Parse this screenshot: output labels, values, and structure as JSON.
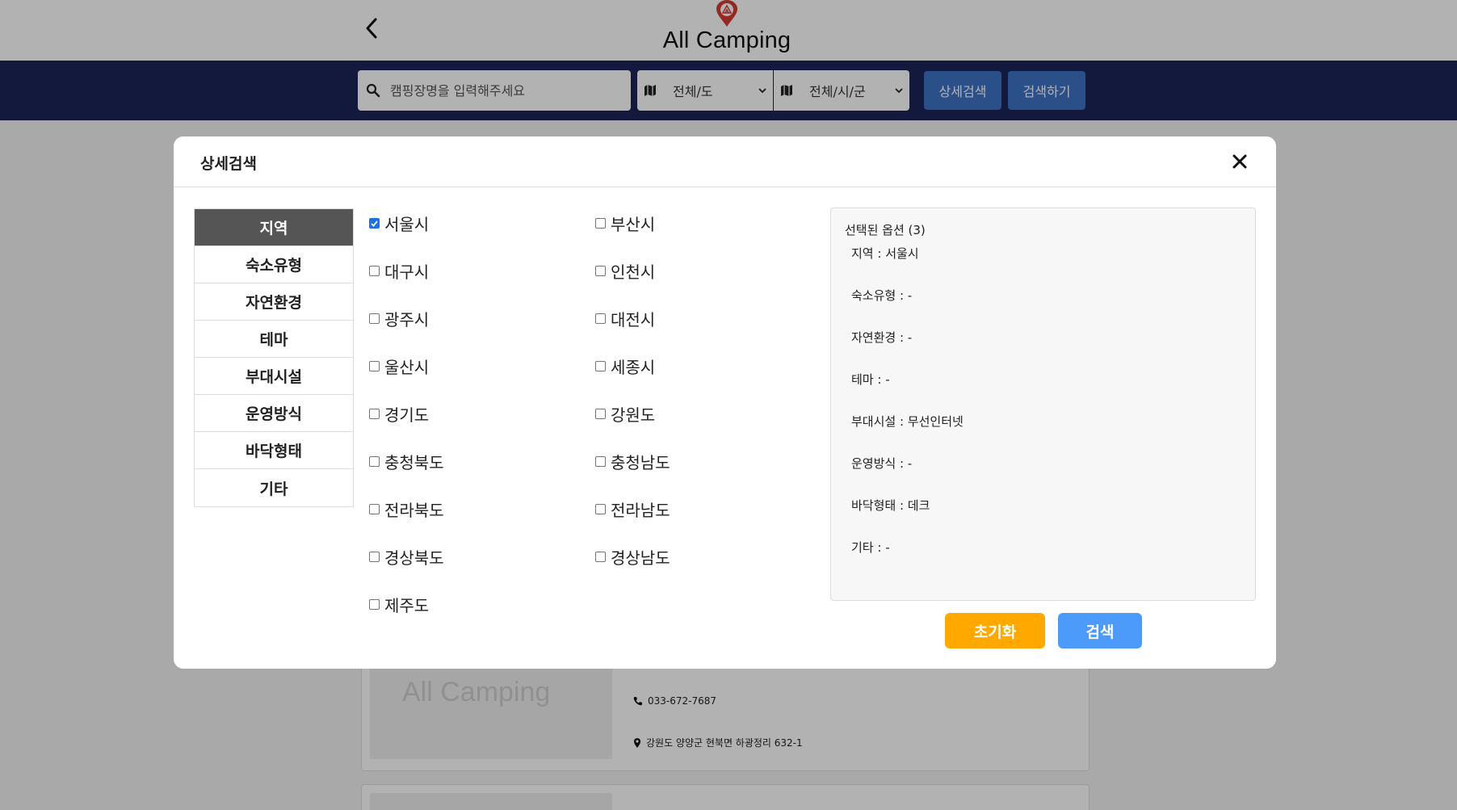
{
  "header": {
    "logo_text": "All Camping"
  },
  "search": {
    "placeholder": "캠핑장명을 입력해주세요",
    "province_select": "전체/도",
    "city_select": "전체/시/군",
    "detail_search_label": "상세검색",
    "search_label": "검색하기"
  },
  "background_listing": {
    "thumb_logo": "All Camping",
    "phone": "033-672-7687",
    "address": "강원도 양양군 현북면 하광정리 632-1"
  },
  "modal": {
    "title": "상세검색",
    "categories": [
      {
        "label": "지역",
        "active": true
      },
      {
        "label": "숙소유형",
        "active": false
      },
      {
        "label": "자연환경",
        "active": false
      },
      {
        "label": "테마",
        "active": false
      },
      {
        "label": "부대시설",
        "active": false
      },
      {
        "label": "운영방식",
        "active": false
      },
      {
        "label": "바닥형태",
        "active": false
      },
      {
        "label": "기타",
        "active": false
      }
    ],
    "regions": [
      {
        "label": "서울시",
        "checked": true
      },
      {
        "label": "부산시",
        "checked": false
      },
      {
        "label": "대구시",
        "checked": false
      },
      {
        "label": "인천시",
        "checked": false
      },
      {
        "label": "광주시",
        "checked": false
      },
      {
        "label": "대전시",
        "checked": false
      },
      {
        "label": "울산시",
        "checked": false
      },
      {
        "label": "세종시",
        "checked": false
      },
      {
        "label": "경기도",
        "checked": false
      },
      {
        "label": "강원도",
        "checked": false
      },
      {
        "label": "충청북도",
        "checked": false
      },
      {
        "label": "충청남도",
        "checked": false
      },
      {
        "label": "전라북도",
        "checked": false
      },
      {
        "label": "전라남도",
        "checked": false
      },
      {
        "label": "경상북도",
        "checked": false
      },
      {
        "label": "경상남도",
        "checked": false
      },
      {
        "label": "제주도",
        "checked": false
      }
    ],
    "summary": {
      "heading": "선택된 옵션 (3)",
      "rows": [
        "지역 : 서울시",
        "숙소유형 : -",
        "자연환경 : -",
        "테마 : -",
        "부대시설 : 무선인터넷",
        "운영방식 : -",
        "바닥형태 : 데크",
        "기타 : -"
      ]
    },
    "reset_label": "초기화",
    "apply_label": "검색"
  },
  "colors": {
    "navy": "#1c2557",
    "button_blue": "#3d72c4",
    "reset_orange": "#ffa800",
    "apply_blue": "#4c9bfa",
    "active_tab": "#555555",
    "logo_pin": "#d63a33"
  }
}
